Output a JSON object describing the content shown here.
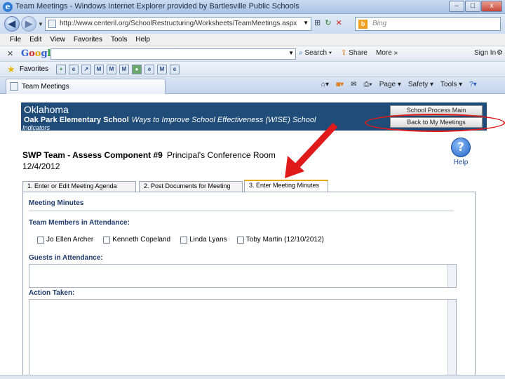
{
  "window": {
    "title": "Team Meetings - Windows Internet Explorer provided by Bartlesville Public Schools",
    "controls": [
      "–",
      "□",
      "x"
    ]
  },
  "address": {
    "url": "http://www.centeril.org/SchoolRestructuring/Worksheets/TeamMeetings.aspx",
    "search_placeholder": "Bing"
  },
  "menu": [
    "File",
    "Edit",
    "View",
    "Favorites",
    "Tools",
    "Help"
  ],
  "google_toolbar": {
    "logo": [
      "G",
      "o",
      "o",
      "g",
      "l",
      "e"
    ],
    "search_btn": "Search",
    "share_btn": "Share",
    "more_btn": "More »",
    "signin": "Sign In"
  },
  "favorites": {
    "label": "Favorites",
    "icons": [
      "M",
      "M",
      "M",
      "M"
    ]
  },
  "browser_tab": {
    "title": "Team Meetings"
  },
  "command_bar": [
    "Page ▾",
    "Safety ▾",
    "Tools ▾"
  ],
  "page": {
    "state": "Oklahoma",
    "school": "Oak Park Elementary School",
    "wise": "Ways to Improve School Effectiveness (WISE)   School",
    "indicators": "Indicators",
    "school_process_btn": "School Process Main",
    "back_btn": "Back to My Meetings",
    "heading": "SWP Team - Assess Component #9",
    "room": "Principal's Conference Room",
    "date": "12/4/2012",
    "help_label": "Help",
    "help_symbol": "?",
    "tabs": [
      "1.  Enter or Edit Meeting Agenda",
      "2.  Post Documents for Meeting",
      "3.  Enter Meeting Minutes"
    ],
    "minutes_title": "Meeting Minutes",
    "members_title": "Team Members in Attendance:",
    "members": [
      "Jo Ellen Archer",
      "Kenneth Copeland",
      "Linda Lyans",
      "Toby Martin (12/10/2012)"
    ],
    "guests_title": "Guests in Attendance:",
    "action_title": "Action Taken:"
  },
  "colors": {
    "banner": "#1f4c78",
    "annotation": "#e01a1a",
    "active_tab": "#e8a800"
  }
}
